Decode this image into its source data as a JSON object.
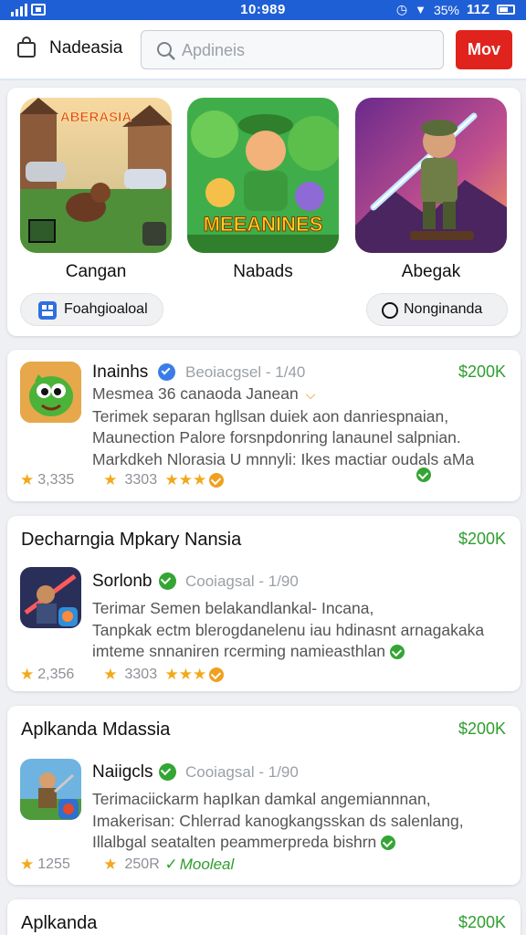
{
  "status_bar": {
    "time": "10:989",
    "battery": "35%",
    "clock_right": "11Z"
  },
  "header": {
    "brand": "Nadeasia",
    "search_placeholder": "Apdineis",
    "more_label": "Mov"
  },
  "featured": {
    "items": [
      {
        "name": "Cangan",
        "art_text": "ABERASIA"
      },
      {
        "name": "Nabads",
        "art_text": "MEEANINES"
      },
      {
        "name": "Abegak"
      }
    ],
    "chips": [
      {
        "label": "Foahgioaloal"
      },
      {
        "label": "Nonginanda"
      }
    ]
  },
  "listings": [
    {
      "app_name": "Inainhs",
      "category": "Beoiacgsel",
      "size": "1/40",
      "price": "$200K",
      "desc_lines": [
        "Mesmea 36 canaoda Janean",
        "Terimek separan hgllsan duiek aon danriespnaian,",
        "Maunection Palore forsnpdonring lanaunel salpnian.",
        "Markdkeh Nlorasia U mnnyli: Ikes mactiar oudals aMa"
      ],
      "rating_count": "3,335",
      "downloads": "3303"
    },
    {
      "section_title": "Decharngia Mpkary Nansia",
      "app_name": "Sorlonb",
      "category": "Cooiagsal",
      "size": "1/90",
      "price": "$200K",
      "desc_lines": [
        "Terimar Semen belakandlankal- Incana,",
        "Tanpkak ectm blerogdanelenu iau hdinasnt arnagakaka",
        "imteme snnaniren rcerming namieasthlan"
      ],
      "rating_count": "2,356",
      "downloads": "3303"
    },
    {
      "section_title": "Aplkanda Mdassia",
      "app_name": "Naiigcls",
      "category": "Cooiagsal",
      "size": "1/90",
      "price": "$200K",
      "desc_lines": [
        "Terimaciickarm hapIkan damkal angemiannnan,",
        "Imakerisan: Chlerrad kanogkangsskan ds salenlang,",
        "Illalbgal seatalten peammerpreda bishrn"
      ],
      "rating_count": "1255",
      "downloads": "250R",
      "badge": "Mooleal"
    },
    {
      "section_title": "Aplkanda",
      "price": "$200K"
    }
  ],
  "colors": {
    "accent_blue": "#1f5fd6",
    "action_red": "#e0231c",
    "price_green": "#2f9e2f",
    "star_gold": "#f2a91a"
  }
}
